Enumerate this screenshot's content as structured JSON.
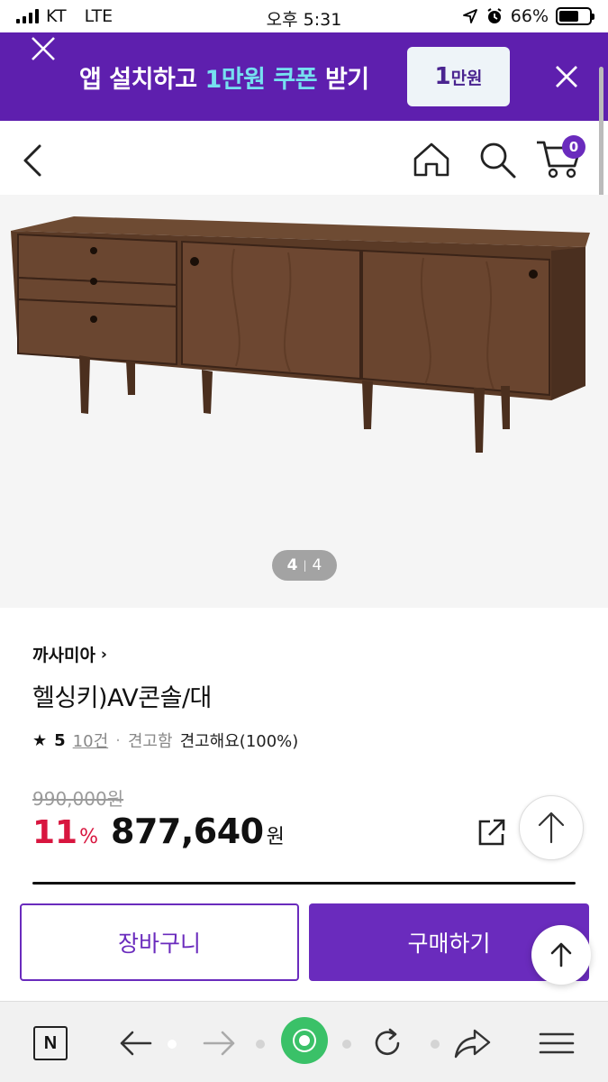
{
  "status_bar": {
    "carrier": "KT",
    "network": "LTE",
    "time": "오후 5:31",
    "battery": "66%",
    "battery_level": 0.66
  },
  "promo": {
    "text_prefix": "앱 설치하고 ",
    "text_highlight": "1만원 쿠폰",
    "text_suffix": " 받기",
    "coupon_amount": "1",
    "coupon_unit": "만원"
  },
  "header": {
    "cart_count": "0"
  },
  "gallery": {
    "current": "4",
    "separator": "|",
    "total": "4"
  },
  "product": {
    "brand": "까사미아",
    "brand_chevron": "›",
    "title": "헬싱키)AV콘솔/대",
    "rating_star": "★",
    "rating_score": "5",
    "review_count": "10건",
    "rating_dot": "·",
    "review_tag": "견고함",
    "review_summary": "견고해요(100%)",
    "original_price": "990,000원",
    "discount_value": "11",
    "discount_unit": "%",
    "price": "877,640",
    "price_unit": "원"
  },
  "actions": {
    "cart_label": "장바구니",
    "buy_label": "구매하기"
  },
  "browser_toolbar": {
    "logo_letter": "N"
  },
  "colors": {
    "brand_purple": "#6a2bbd",
    "promo_purple": "#5e1fae",
    "promo_highlight": "#76e0f0",
    "discount_red": "#d8163f",
    "browser_green": "#3ac168"
  }
}
